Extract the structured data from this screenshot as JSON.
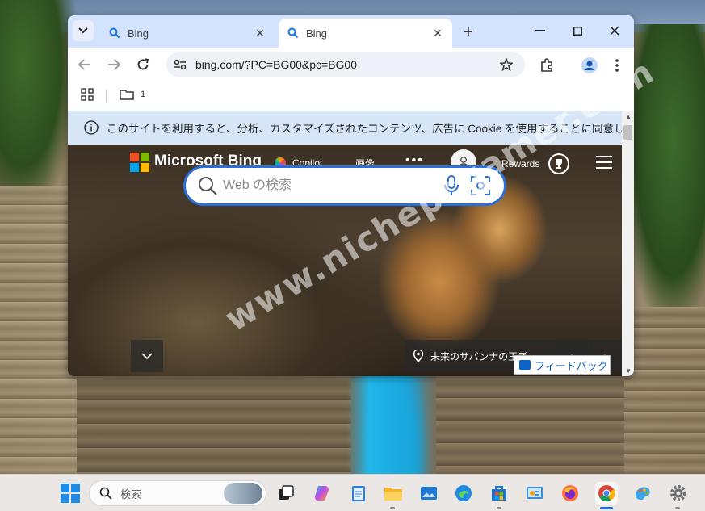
{
  "browser": {
    "tabs": [
      {
        "title": "Bing",
        "active": false
      },
      {
        "title": "Bing",
        "active": true
      }
    ],
    "url": "bing.com/?PC=BG00&pc=BG00",
    "bookmark_folder": "1"
  },
  "cookie_notice": "このサイトを利用すると、分析、カスタマイズされたコンテンツ、広告に Cookie を使用することに同意したことになります。",
  "bing": {
    "brand": "Microsoft Bing",
    "nav_copilot": "Copilot",
    "nav_images": "画像",
    "nav_more": "•••",
    "rewards": "Rewards",
    "search_placeholder": "Web の検索",
    "caption": "未来のサバンナの王者",
    "feedback": "フィードバック"
  },
  "watermark": "www.nichepcgamer.com",
  "taskbar": {
    "search_label": "検索",
    "apps": [
      "task-view",
      "copilot",
      "notepad",
      "file-explorer",
      "photos",
      "edge",
      "store",
      "control-panel",
      "firefox",
      "chrome",
      "paint",
      "settings"
    ],
    "active_app": "chrome"
  },
  "colors": {
    "tabstrip": "#d3e3fd",
    "search_border": "#2b6fd6",
    "feedback_text": "#0a63c9",
    "ms_red": "#f25022",
    "ms_green": "#7fba00",
    "ms_blue": "#00a4ef",
    "ms_yellow": "#ffb900"
  }
}
